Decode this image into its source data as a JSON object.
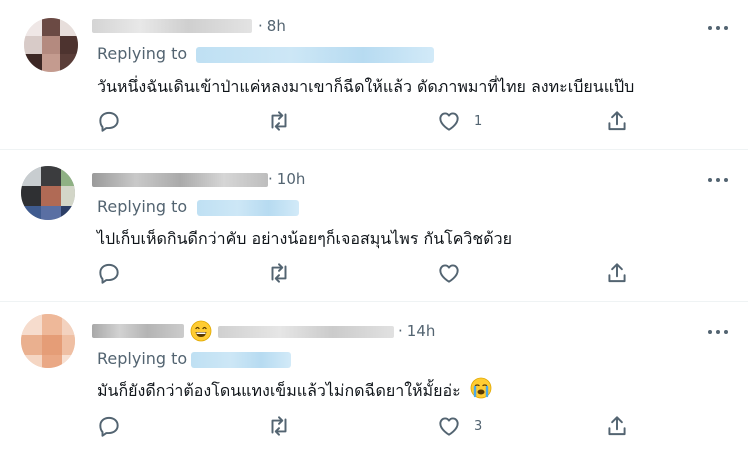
{
  "replies": [
    {
      "time": "8h",
      "replying_label": "Replying to",
      "text": "วันหนึ่งฉันเดินเข้าป่าแค่หลงมาเขาก็ฉีดให้แล้ว ดัดภาพมาที่ไทย ลงทะเบียนแป๊บ",
      "like_count": "1",
      "reply_count": "",
      "retweet_count": "",
      "icons": [
        "reply-icon",
        "retweet-icon",
        "like-icon",
        "share-icon",
        "more-icon"
      ]
    },
    {
      "time": "10h",
      "replying_label": "Replying to",
      "text": "ไปเก็บเห็ดกินดีกว่าคับ อย่างน้อยๆก็เจอสมุนไพร กันโควิชด้วย",
      "like_count": "",
      "reply_count": "",
      "retweet_count": "",
      "icons": [
        "reply-icon",
        "retweet-icon",
        "like-icon",
        "share-icon",
        "more-icon"
      ]
    },
    {
      "time": "14h",
      "replying_label": "Replying to",
      "text": "มันก็ยังดีกว่าต้องโดนแทงเข็มแล้วไม่กดฉีดยาให้มั้ยอ่ะ",
      "like_count": "3",
      "reply_count": "",
      "retweet_count": "",
      "name_emoji": "grinning-face",
      "text_emoji": "crying-face",
      "icons": [
        "reply-icon",
        "retweet-icon",
        "like-icon",
        "share-icon",
        "more-icon"
      ]
    }
  ],
  "colors": {
    "text": "#0f1419",
    "secondary": "#536471",
    "divider": "#eff3f4",
    "blurred_link": "#c4e3f5"
  }
}
